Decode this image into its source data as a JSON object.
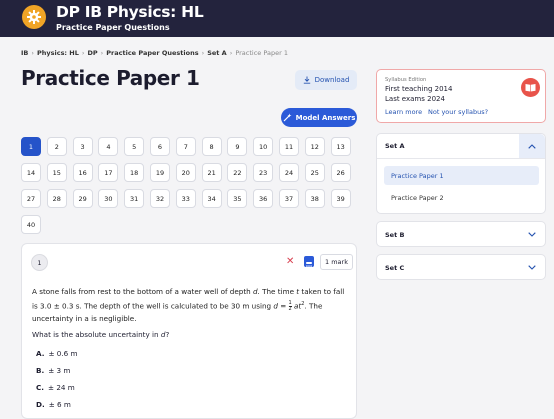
{
  "header": {
    "title": "DP IB Physics: HL",
    "subtitle": "Practice Paper Questions"
  },
  "breadcrumb": [
    "IB",
    "Physics: HL",
    "DP",
    "Practice Paper Questions",
    "Set A",
    "Practice Paper 1"
  ],
  "page": {
    "title": "Practice Paper 1",
    "download_label": "Download",
    "model_answers_label": "Model Answers"
  },
  "questions": [
    "1",
    "2",
    "3",
    "4",
    "5",
    "6",
    "7",
    "8",
    "9",
    "10",
    "11",
    "12",
    "13",
    "14",
    "15",
    "16",
    "17",
    "18",
    "19",
    "20",
    "21",
    "22",
    "23",
    "24",
    "25",
    "26",
    "27",
    "28",
    "29",
    "30",
    "31",
    "32",
    "33",
    "34",
    "35",
    "36",
    "37",
    "38",
    "39",
    "40"
  ],
  "active_question": "1",
  "question": {
    "number": "1",
    "marks": "1 mark",
    "text_p1": "A stone falls from rest to the bottom of a water well of depth ",
    "var_d": "d",
    "text_p2": ". The time ",
    "var_t": "t",
    "text_p3": " taken to fall is 3.0 ± 0.3 s. The depth of the well is calculated to be 30 m using ",
    "eq_lhs": "d",
    "eq_eq": " = ",
    "frac_n": "1",
    "frac_d": "2",
    "eq_rhs": "at",
    "eq_sup": "2",
    "text_p4": ". The uncertainty in a is negligible.",
    "ask": "What is the absolute uncertainty in ",
    "ask_var": "d",
    "ask_end": "?",
    "options": [
      {
        "letter": "A.",
        "text": "± 0.6 m"
      },
      {
        "letter": "B.",
        "text": "± 3 m"
      },
      {
        "letter": "C.",
        "text": "± 24 m"
      },
      {
        "letter": "D.",
        "text": "± 6 m"
      }
    ]
  },
  "syllabus": {
    "label": "Syllabus Edition",
    "line1": "First teaching 2014",
    "line2": "Last exams 2024",
    "learn_more": "Learn more",
    "not_your": "Not your syllabus?"
  },
  "sets": [
    {
      "name": "Set A",
      "items": [
        "Practice Paper 1",
        "Practice Paper 2"
      ]
    },
    {
      "name": "Set B"
    },
    {
      "name": "Set C"
    }
  ],
  "colors": {
    "header": "#23233d",
    "accent": "#2553c9",
    "logo": "#f0a426",
    "alert": "#e8534a"
  }
}
